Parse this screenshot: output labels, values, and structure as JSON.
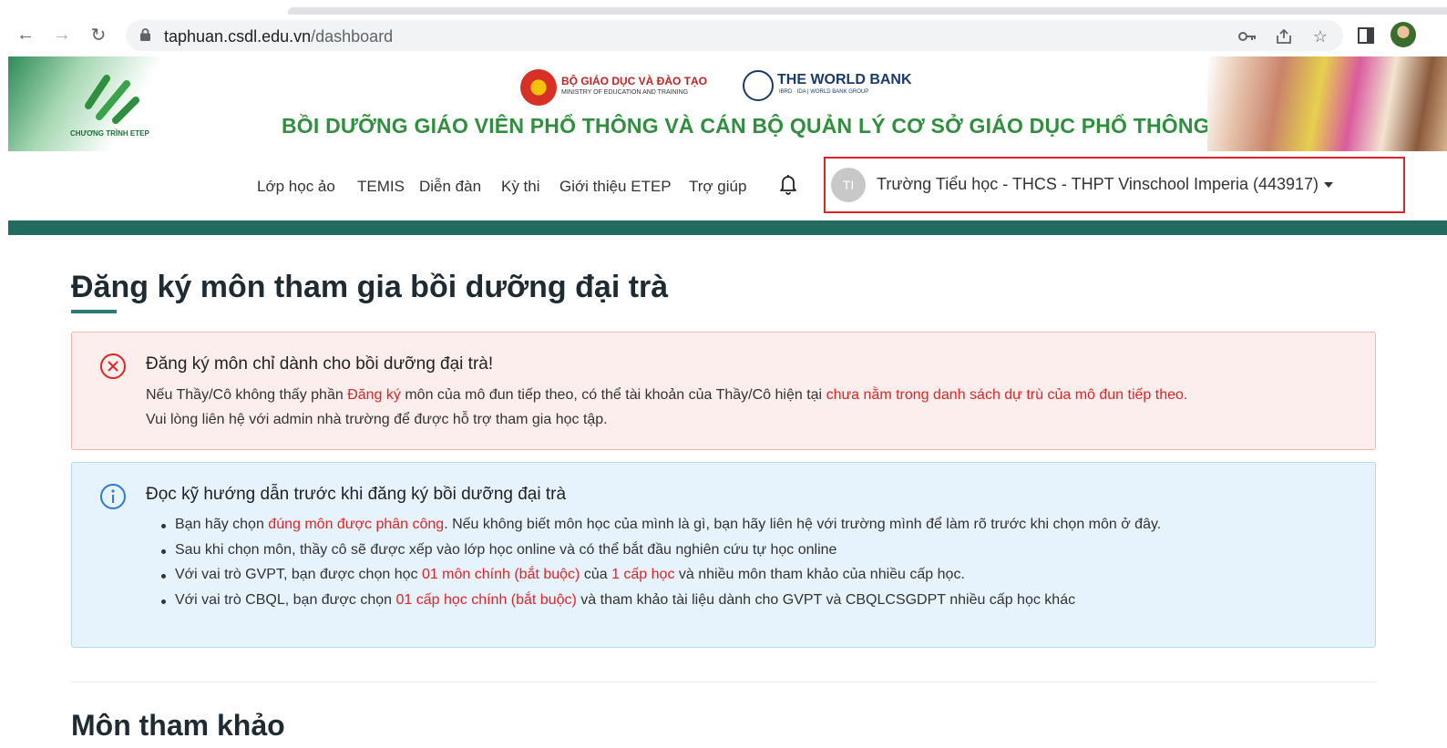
{
  "browser": {
    "url_host": "taphuan.csdl.edu.vn",
    "url_path": "/dashboard"
  },
  "header": {
    "logo_caption": "CHƯƠNG TRÌNH ETEP",
    "ministry_title": "BỘ GIÁO DỤC VÀ ĐÀO TẠO",
    "ministry_subtitle": "MINISTRY OF EDUCATION AND TRAINING",
    "worldbank_title": "THE WORLD BANK",
    "worldbank_subtitle": "IBRD · IDA | WORLD BANK GROUP",
    "program_title": "BỒI DƯỠNG GIÁO VIÊN PHỔ THÔNG VÀ CÁN BỘ QUẢN LÝ CƠ SỞ GIÁO DỤC PHỔ THÔNG"
  },
  "nav": {
    "items": [
      "Lớp học ảo",
      "TEMIS",
      "Diễn đàn",
      "Kỳ thi",
      "Giới thiệu ETEP",
      "Trợ giúp"
    ],
    "user_initials": "TI",
    "user_name": "Trường Tiểu học - THCS - THPT Vinschool Imperia (443917)"
  },
  "main": {
    "title": "Đăng ký môn tham gia bồi dưỡng đại trà",
    "warning": {
      "title": "Đăng ký môn chỉ dành cho bồi dưỡng đại trà!",
      "line1_a": "Nếu Thầy/Cô không thấy phần ",
      "line1_b": "Đăng ký",
      "line1_c": " môn của mô đun tiếp theo, có thể tài khoản của Thầy/Cô hiện tại ",
      "line1_d": "chưa nằm trong danh sách dự trù của mô đun tiếp theo.",
      "line2": "Vui lòng liên hệ với admin nhà trường để được hỗ trợ tham gia học tập."
    },
    "info": {
      "title": "Đọc kỹ hướng dẫn trước khi đăng ký bồi dưỡng đại trà",
      "b1_a": "Bạn hãy chọn ",
      "b1_b": "đúng môn được phân công",
      "b1_c": ". Nếu không biết môn học của mình là gì, bạn hãy liên hệ với trường mình để làm rõ trước khi chọn môn ở đây.",
      "b2": "Sau khi chọn môn, thầy cô sẽ được xếp vào lớp học online và có thể bắt đầu nghiên cứu tự học online",
      "b3_a": "Với vai trò GVPT, bạn được chọn học ",
      "b3_b": "01 môn chính (bắt buộc)",
      "b3_c": " của ",
      "b3_d": "1 cấp học",
      "b3_e": " và nhiều môn tham khảo của nhiều cấp học.",
      "b4_a": "Với vai trò CBQL, bạn được chọn ",
      "b4_b": "01 cấp học chính (bắt buộc)",
      "b4_c": " và tham khảo tài liệu dành cho GVPT và CBQLCSGDPT nhiều cấp học khác"
    },
    "section_title": "Môn tham khảo"
  }
}
